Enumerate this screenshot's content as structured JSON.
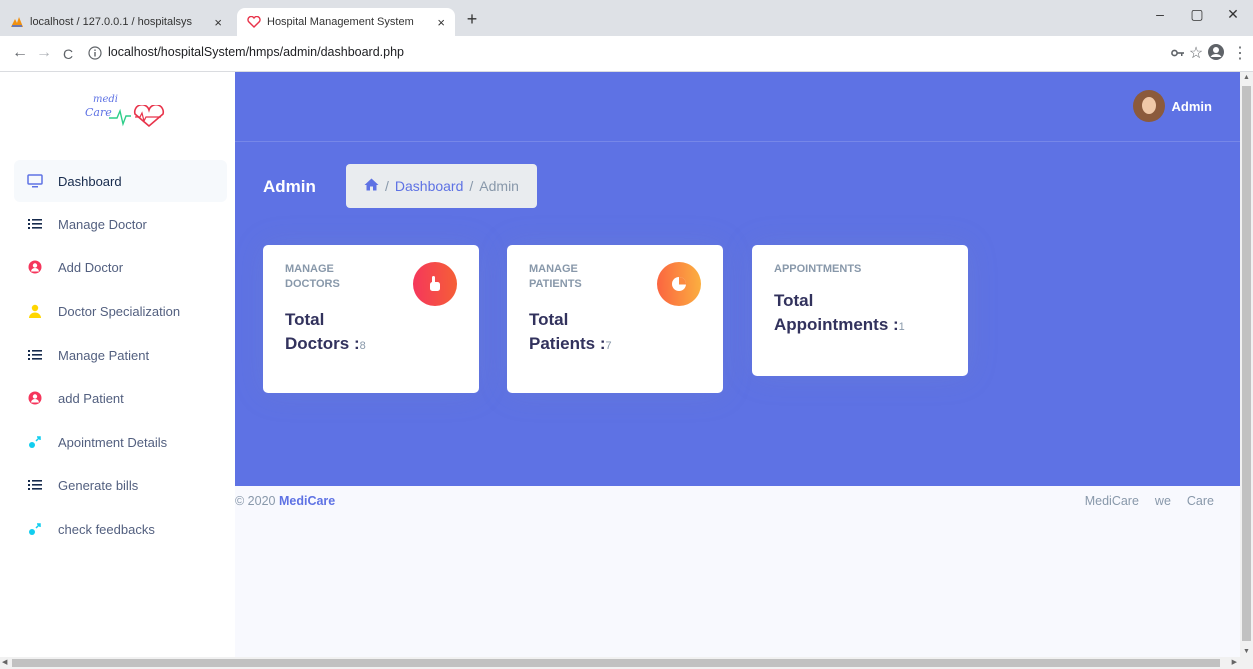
{
  "browser": {
    "tabs": [
      {
        "label": "localhost / 127.0.0.1 / hospitalsys",
        "icon": "phpmyadmin-icon",
        "close": "×"
      },
      {
        "label": "Hospital Management System",
        "icon": "heart-logo-icon",
        "close": "×"
      }
    ],
    "new_tab": "+",
    "window_controls": {
      "minimize": "–",
      "maximize": "▢",
      "close": "✕"
    },
    "url": "localhost/hospitalSystem/hmps/admin/dashboard.php",
    "nav": {
      "back": "←",
      "forward": "→",
      "reload": "C"
    },
    "right_icons": {
      "key": "key-icon",
      "star": "☆",
      "menu": "⋮"
    }
  },
  "logo": {
    "top": "medi",
    "bottom": "Care"
  },
  "sidebar": {
    "items": [
      {
        "label": "Dashboard",
        "icon": "monitor-icon",
        "color": "#5e72e4"
      },
      {
        "label": "Manage Doctor",
        "icon": "list-icon",
        "color": "#172b4d"
      },
      {
        "label": "Add Doctor",
        "icon": "user-circle-icon",
        "color": "#f5365c"
      },
      {
        "label": "Doctor Specialization",
        "icon": "user-icon",
        "color": "#ffd600"
      },
      {
        "label": "Manage Patient",
        "icon": "list-icon",
        "color": "#172b4d"
      },
      {
        "label": "add Patient",
        "icon": "user-circle-icon",
        "color": "#f5365c"
      },
      {
        "label": "Apointment Details",
        "icon": "planet-icon",
        "color": "#11cdef"
      },
      {
        "label": "Generate bills",
        "icon": "list-icon",
        "color": "#172b4d"
      },
      {
        "label": "check feedbacks",
        "icon": "planet-icon",
        "color": "#11cdef"
      }
    ]
  },
  "header": {
    "user_name": "Admin",
    "page_heading": "Admin",
    "breadcrumb": {
      "home_icon": "home-icon",
      "sep": "/",
      "link": "Dashboard",
      "current": "Admin"
    }
  },
  "cards": [
    {
      "label_line1": "MANAGE",
      "label_line2": "DOCTORS",
      "value_line1": "Total",
      "value_line2": "Doctors :",
      "count": "8",
      "icon": "hand-pointer-icon",
      "icon_color": "#f5365c"
    },
    {
      "label_line1": "MANAGE",
      "label_line2": "PATIENTS",
      "value_line1": "Total",
      "value_line2": "Patients :",
      "count": "7",
      "icon": "chart-pie-icon",
      "icon_color": "#fb6340"
    },
    {
      "label_line1": "APPOINTMENTS",
      "label_line2": "",
      "value_line1": "Total",
      "value_line2": "Appointments :",
      "count": "1"
    }
  ],
  "footer": {
    "copyright": "© 2020",
    "brand": "MediCare",
    "links": [
      "MediCare",
      "we",
      "Care"
    ]
  },
  "colors": {
    "primary": "#5e72e4",
    "sidebar_bg": "#ffffff",
    "page_bg": "#f8f9fe"
  }
}
